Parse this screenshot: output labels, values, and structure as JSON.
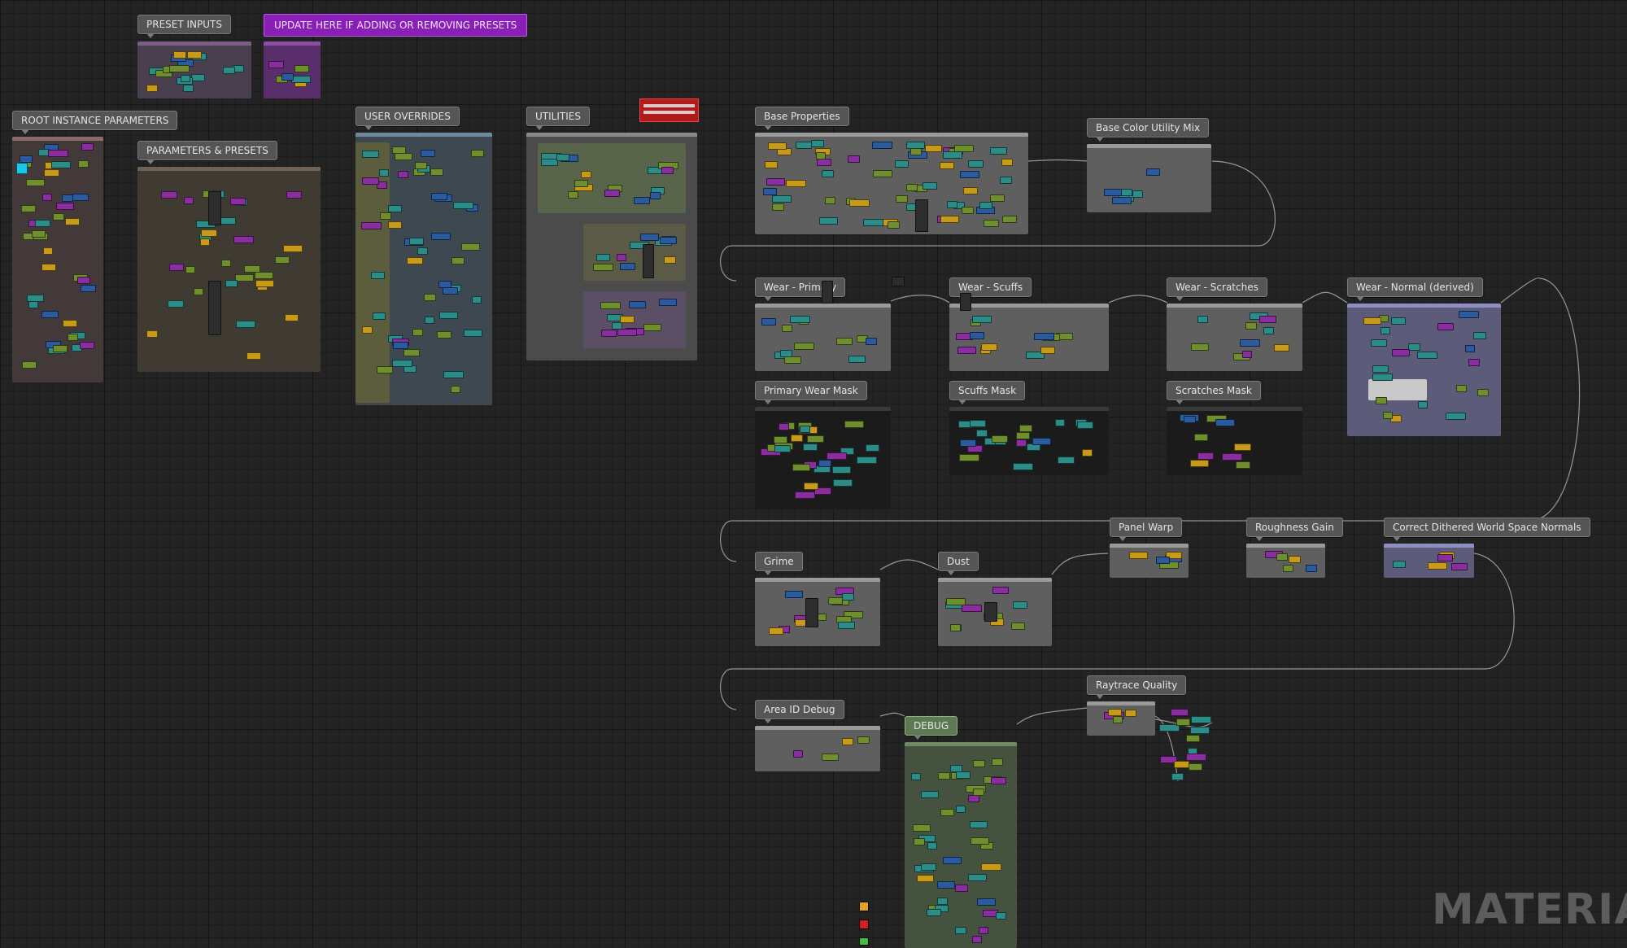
{
  "editor": {
    "watermark": "MATERIAL"
  },
  "banner": {
    "label": "UPDATE HERE IF ADDING OR REMOVING PRESETS"
  },
  "groups": [
    {
      "id": "preset-inputs",
      "label": "PRESET INPUTS"
    },
    {
      "id": "root-instance-parameters",
      "label": "ROOT INSTANCE PARAMETERS"
    },
    {
      "id": "parameters-presets",
      "label": "PARAMETERS & PRESETS"
    },
    {
      "id": "user-overrides",
      "label": "USER OVERRIDES"
    },
    {
      "id": "utilities",
      "label": "UTILITIES"
    },
    {
      "id": "base-properties",
      "label": "Base Properties"
    },
    {
      "id": "base-color-utility-mix",
      "label": "Base Color Utility Mix"
    },
    {
      "id": "wear-primary",
      "label": "Wear - Primary"
    },
    {
      "id": "wear-scuffs",
      "label": "Wear - Scuffs"
    },
    {
      "id": "wear-scratches",
      "label": "Wear - Scratches"
    },
    {
      "id": "wear-normal-derived",
      "label": "Wear - Normal (derived)"
    },
    {
      "id": "primary-wear-mask",
      "label": "Primary Wear Mask"
    },
    {
      "id": "scuffs-mask",
      "label": "Scuffs Mask"
    },
    {
      "id": "scratches-mask",
      "label": "Scratches Mask"
    },
    {
      "id": "panel-warp",
      "label": "Panel Warp"
    },
    {
      "id": "roughness-gain",
      "label": "Roughness Gain"
    },
    {
      "id": "correct-dithered-world-space-normals",
      "label": "Correct Dithered World Space Normals"
    },
    {
      "id": "grime",
      "label": "Grime"
    },
    {
      "id": "dust",
      "label": "Dust"
    },
    {
      "id": "raytrace-quality",
      "label": "Raytrace Quality"
    },
    {
      "id": "area-id-debug",
      "label": "Area ID Debug"
    },
    {
      "id": "debug",
      "label": "DEBUG"
    }
  ],
  "colors": {
    "background": "#232323",
    "banner": "#8a1fb8",
    "node_green": "#6f8f2e",
    "node_teal": "#2b8c88",
    "node_purple": "#8a2d9e",
    "node_blue": "#2c5a9e",
    "node_red": "#b32222",
    "node_yellow": "#c89a1a",
    "wire": "#bdbdbd"
  },
  "icons": [
    "node-graph-wire",
    "reroute-node-icon",
    "comment-bubble-icon"
  ]
}
